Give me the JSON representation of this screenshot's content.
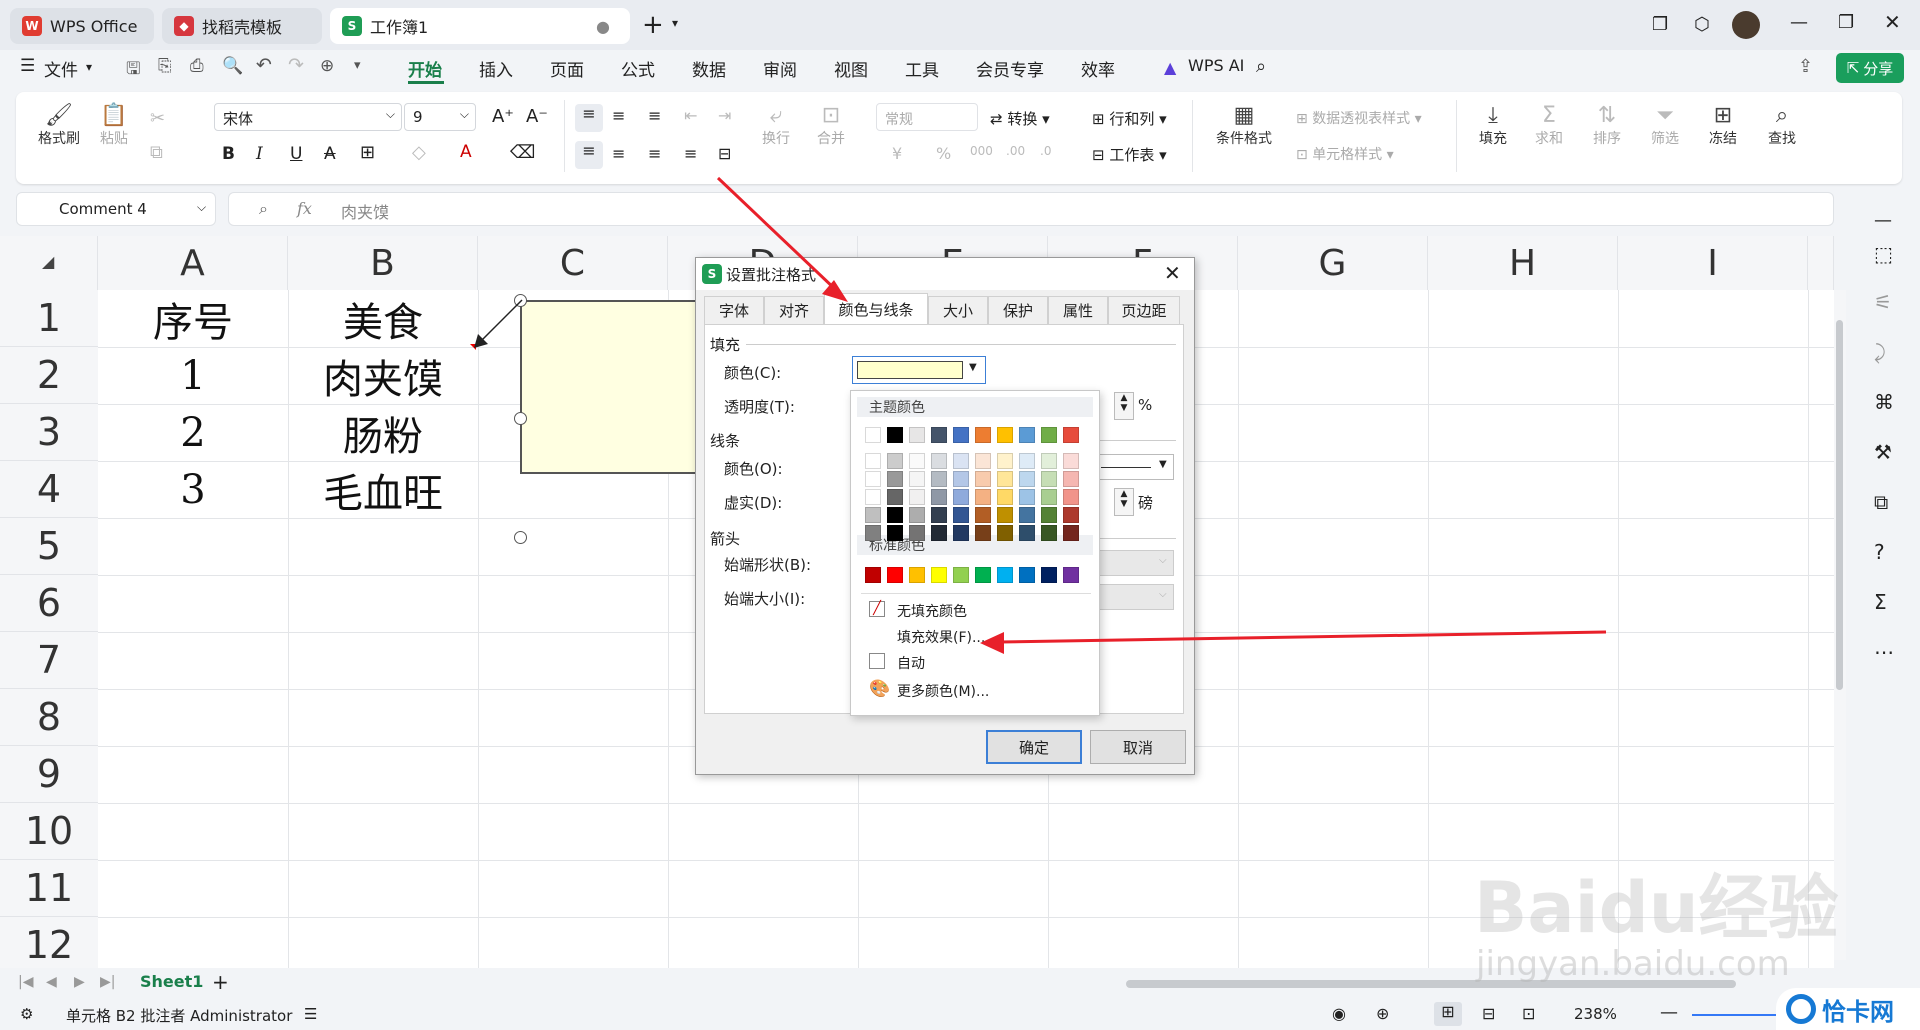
{
  "tabs": [
    {
      "label": "WPS Office"
    },
    {
      "label": "找稻壳模板"
    },
    {
      "label": "工作簿1"
    }
  ],
  "menu": {
    "file": "文件",
    "items": [
      "开始",
      "插入",
      "页面",
      "公式",
      "数据",
      "审阅",
      "视图",
      "工具",
      "会员专享",
      "效率"
    ],
    "wps_ai": "WPS AI",
    "share": "分享"
  },
  "ribbon": {
    "format_painter": "格式刷",
    "paste": "粘贴",
    "font_name": "宋体",
    "font_size": "9",
    "wrap": "换行",
    "merge": "合并",
    "number_format": "常规",
    "convert": "转换",
    "row_col": "行和列",
    "worksheet": "工作表",
    "cond_format": "条件格式",
    "pivot_style": "数据透视表样式",
    "cell_style": "单元格样式",
    "fill": "填充",
    "sum": "求和",
    "sort": "排序",
    "filter": "筛选",
    "freeze": "冻结",
    "find": "查找"
  },
  "formula": {
    "name_box": "Comment 4",
    "fx": "fx",
    "content": "肉夹馍"
  },
  "columns": [
    "A",
    "B",
    "C",
    "D",
    "E",
    "F",
    "G",
    "H",
    "I"
  ],
  "rows": [
    "1",
    "2",
    "3",
    "4",
    "5",
    "6",
    "7",
    "8",
    "9",
    "10",
    "11",
    "12"
  ],
  "cells": {
    "a1": "序号",
    "b1": "美食",
    "a2": "1",
    "b2": "肉夹馍",
    "a3": "2",
    "b3": "肠粉",
    "a4": "3",
    "b4": "毛血旺"
  },
  "sheet": {
    "name": "Sheet1"
  },
  "status": {
    "text": "单元格 B2 批注者 Administrator",
    "zoom": "238%"
  },
  "dialog": {
    "title": "设置批注格式",
    "tabs": [
      "字体",
      "对齐",
      "颜色与线条",
      "大小",
      "保护",
      "属性",
      "页边距"
    ],
    "fill_section": "填充",
    "color_label": "颜色(C):",
    "transparency_label": "透明度(T):",
    "percent": "%",
    "line_section": "线条",
    "line_color_label": "颜色(O):",
    "dash_label": "虚实(D):",
    "weight_unit": "磅",
    "arrow_section": "箭头",
    "begin_style_label": "始端形状(B):",
    "begin_size_label": "始端大小(I):",
    "ok": "确定",
    "cancel": "取消"
  },
  "popup": {
    "theme_title": "主题颜色",
    "standard_title": "标准颜色",
    "no_fill": "无填充颜色",
    "fill_effect": "填充效果(F)...",
    "auto": "自动",
    "more_colors": "更多颜色(M)...",
    "theme_top": [
      "#ffffff",
      "#000000",
      "#e7e6e6",
      "#44546a",
      "#4472c4",
      "#ed7d31",
      "#ffc000",
      "#5b9bd5",
      "#70ad47",
      "#e74c3c"
    ],
    "standard": [
      "#c00000",
      "#ff0000",
      "#ffc000",
      "#ffff00",
      "#92d050",
      "#00b050",
      "#00b0f0",
      "#0070c0",
      "#002060",
      "#7030a0"
    ]
  },
  "watermark": {
    "text": "jingyan.baidu.com",
    "corner": "恰卡网"
  }
}
